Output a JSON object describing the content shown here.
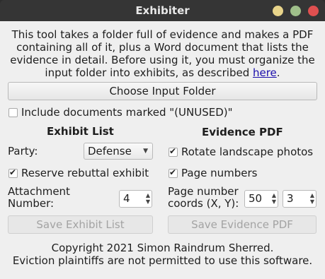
{
  "window": {
    "title": "Exhibiter"
  },
  "intro": {
    "text": "This tool takes a folder full of evidence and makes a PDF containing all of it, plus a Word document that lists the evidence in detail. Before using it, you must organize the input folder into exhibits, as described ",
    "link": "here",
    "end": "."
  },
  "choose_folder": {
    "label": "Choose Input Folder"
  },
  "include_unused": {
    "label": "Include documents marked \"(UNUSED)\"",
    "checked": false
  },
  "exhibit_list": {
    "heading": "Exhibit List",
    "party_label": "Party:",
    "party_value": "Defense",
    "reserve_rebuttal": {
      "label": "Reserve rebuttal exhibit",
      "checked": true
    },
    "attachment_label_1": "Attachment",
    "attachment_label_2": "Number:",
    "attachment_value": "4",
    "save_label": "Save Exhibit List"
  },
  "evidence_pdf": {
    "heading": "Evidence PDF",
    "rotate_landscape": {
      "label": "Rotate landscape photos",
      "checked": true
    },
    "page_numbers": {
      "label": "Page numbers",
      "checked": true
    },
    "coords_label_1": "Page number",
    "coords_label_2": "coords (X, Y):",
    "coord_x": "50",
    "coord_y": "3",
    "save_label": "Save Evidence PDF"
  },
  "footer": {
    "copyright": "Copyright 2021 Simon Raindrum Sherred.",
    "notice": "Eviction plaintiffs are not permitted to use this software."
  }
}
